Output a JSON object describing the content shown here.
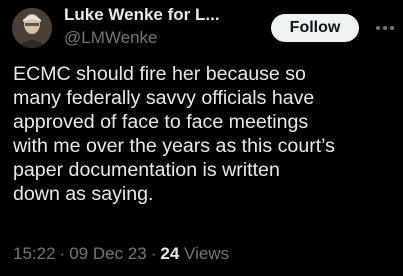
{
  "author": {
    "name": "Luke Wenke for L...",
    "handle": "@LMWenke"
  },
  "actions": {
    "follow_label": "Follow",
    "more_icon": "more-dots-icon"
  },
  "tweet": {
    "lines": [
      "ECMC should fire her because so",
      "many federally savvy officials have",
      "approved of face to face meetings",
      "with me over the years as this court’s",
      "paper documentation is written",
      "down as saying."
    ]
  },
  "meta": {
    "time": "15:22",
    "separator": "·",
    "date": "09 Dec 23",
    "views_count": "24",
    "views_label": "Views"
  },
  "colors": {
    "background": "#000000",
    "text": "#e7e9ea",
    "secondary": "#71767b",
    "button_bg": "#eff3f4",
    "button_text": "#0f1419"
  }
}
